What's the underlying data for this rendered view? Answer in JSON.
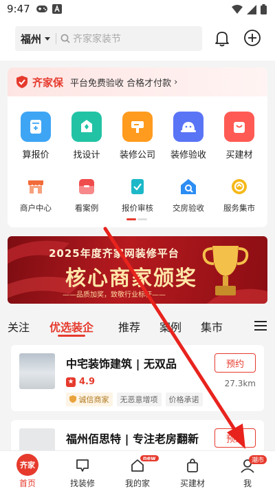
{
  "status_bar": {
    "time": "9:47"
  },
  "header": {
    "city": "福州",
    "search_placeholder": "齐家家装节"
  },
  "promo": {
    "brand": "齐家保",
    "text": "平台免费验收 合格才付款"
  },
  "primary_services": [
    {
      "label": "算报价",
      "color": "#3ea5f5",
      "icon": "calculator-icon"
    },
    {
      "label": "找设计",
      "color": "#22c3a5",
      "icon": "design-icon"
    },
    {
      "label": "装修公司",
      "color": "#ff9b1f",
      "icon": "company-icon"
    },
    {
      "label": "装修验收",
      "color": "#5a74f6",
      "icon": "helmet-icon"
    },
    {
      "label": "买建材",
      "color": "#ff5b54",
      "icon": "shopping-bag-icon"
    }
  ],
  "secondary_services": [
    {
      "label": "商户中心",
      "color": "#f26b3a",
      "icon": "store-icon"
    },
    {
      "label": "看案例",
      "color": "#ef4c4c",
      "icon": "case-icon"
    },
    {
      "label": "报价审核",
      "color": "#1cb8c8",
      "icon": "audit-icon"
    },
    {
      "label": "交房验收",
      "color": "#2c8df3",
      "icon": "house-check-icon"
    },
    {
      "label": "服务集市",
      "color": "#f5b91a",
      "icon": "market-icon"
    }
  ],
  "banner": {
    "line1": "2025年度齐家网装修平台",
    "line2": "核心商家颁奖",
    "line3": "——品质加奖，致敬行业标杆——"
  },
  "tabs": [
    {
      "label": "关注",
      "active": false
    },
    {
      "label": "优选装企",
      "active": true
    },
    {
      "label": "推荐",
      "active": false
    },
    {
      "label": "案例",
      "active": false
    },
    {
      "label": "集市",
      "active": false
    }
  ],
  "shops": [
    {
      "name": "中宅装饰建筑 | 无双品",
      "rating": "4.9",
      "distance": "27.3km",
      "tags": [
        "诚信商家",
        "无恶意增项",
        "价格承诺"
      ],
      "book_label": "预约"
    },
    {
      "name": "福州佰思特 | 专注老房翻新",
      "book_label": "预约"
    }
  ],
  "bottom_nav": [
    {
      "label": "首页",
      "badge": "齐家"
    },
    {
      "label": "找装修"
    },
    {
      "label": "我的家",
      "badge": "new"
    },
    {
      "label": "买建材"
    },
    {
      "label": "我",
      "badge": "潮市"
    }
  ]
}
